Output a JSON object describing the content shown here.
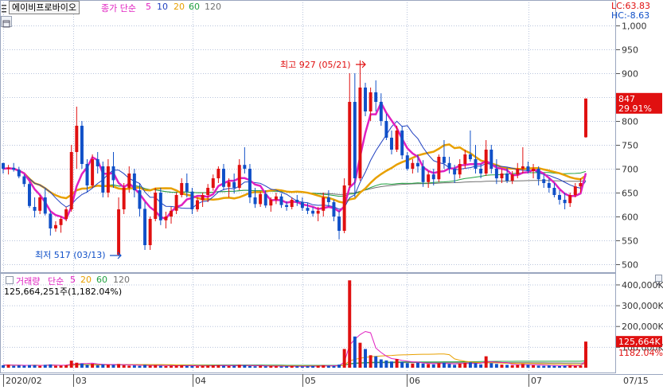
{
  "header": {
    "stock_name": "에이비프로바이오",
    "price_ma_label": "종가 단순",
    "ma_periods": [
      "5",
      "10",
      "20",
      "60",
      "120"
    ],
    "ma_colors": [
      "#e020c0",
      "#2040c0",
      "#e8a000",
      "#20a040",
      "#707070"
    ],
    "lc_text": "LC:63.83",
    "hc_text": "HC:-8.63"
  },
  "volume_header": {
    "label": "거래량",
    "ma_label": "단순",
    "ma_periods": [
      "5",
      "20",
      "60",
      "120"
    ],
    "ma_colors": [
      "#e020c0",
      "#e8a000",
      "#20a040",
      "#707070"
    ],
    "value_text": "125,664,251주(1,182.04%)"
  },
  "price_axis": {
    "ticks": [
      "1,000",
      "950",
      "900",
      "850",
      "800",
      "750",
      "700",
      "650",
      "600",
      "550",
      "500"
    ],
    "current_price": "847",
    "current_change": "29.91%"
  },
  "volume_axis": {
    "ticks": [
      "400,000K",
      "300,000K",
      "200,000K",
      "100,000K"
    ],
    "current_volume": "125,664K",
    "current_ratio": "1182.04%"
  },
  "date_axis": {
    "labels": [
      "2020/02",
      "03",
      "04",
      "05",
      "06",
      "07"
    ],
    "last_date": "07/15"
  },
  "annotations": {
    "high": "최고 927 (05/21)",
    "low": "최저 517 (03/13)"
  },
  "colors": {
    "up": "#e01010",
    "down": "#1050c8",
    "grid": "#b8c4dc",
    "axis_bg": "#ffffff"
  },
  "chart_data": [
    {
      "type": "candlestick",
      "title": "",
      "ylim": [
        490,
        1020
      ],
      "series_note": "daily OHLC",
      "ohlc": [
        [
          712,
          712,
          690,
          700
        ],
        [
          700,
          708,
          688,
          702
        ],
        [
          702,
          712,
          694,
          698
        ],
        [
          698,
          704,
          680,
          684
        ],
        [
          684,
          688,
          662,
          668
        ],
        [
          668,
          672,
          618,
          622
        ],
        [
          620,
          640,
          598,
          612
        ],
        [
          612,
          645,
          605,
          640
        ],
        [
          640,
          660,
          602,
          606
        ],
        [
          606,
          612,
          560,
          575
        ],
        [
          575,
          590,
          568,
          582
        ],
        [
          582,
          600,
          566,
          595
        ],
        [
          595,
          620,
          590,
          615
        ],
        [
          615,
          750,
          610,
          735
        ],
        [
          735,
          830,
          700,
          790
        ],
        [
          790,
          800,
          700,
          710
        ],
        [
          710,
          720,
          650,
          665
        ],
        [
          665,
          730,
          660,
          720
        ],
        [
          720,
          735,
          690,
          705
        ],
        [
          705,
          715,
          640,
          650
        ],
        [
          650,
          720,
          640,
          705
        ],
        [
          705,
          735,
          660,
          676
        ],
        [
          520,
          640,
          517,
          615
        ],
        [
          615,
          670,
          605,
          660
        ],
        [
          660,
          705,
          650,
          690
        ],
        [
          690,
          700,
          640,
          655
        ],
        [
          655,
          670,
          600,
          616
        ],
        [
          616,
          630,
          530,
          540
        ],
        [
          540,
          600,
          530,
          595
        ],
        [
          595,
          660,
          590,
          650
        ],
        [
          650,
          660,
          582,
          592
        ],
        [
          592,
          610,
          575,
          600
        ],
        [
          600,
          620,
          585,
          612
        ],
        [
          612,
          650,
          605,
          645
        ],
        [
          645,
          680,
          640,
          670
        ],
        [
          670,
          690,
          640,
          652
        ],
        [
          652,
          660,
          605,
          615
        ],
        [
          615,
          640,
          610,
          634
        ],
        [
          634,
          650,
          620,
          645
        ],
        [
          645,
          668,
          630,
          660
        ],
        [
          660,
          688,
          654,
          680
        ],
        [
          680,
          705,
          670,
          700
        ],
        [
          700,
          710,
          655,
          662
        ],
        [
          662,
          680,
          640,
          672
        ],
        [
          672,
          690,
          648,
          660
        ],
        [
          660,
          720,
          655,
          708
        ],
        [
          708,
          745,
          690,
          700
        ],
        [
          700,
          710,
          628,
          640
        ],
        [
          640,
          660,
          618,
          626
        ],
        [
          626,
          652,
          620,
          647
        ],
        [
          647,
          655,
          618,
          623
        ],
        [
          623,
          640,
          610,
          635
        ],
        [
          635,
          650,
          626,
          642
        ],
        [
          642,
          648,
          618,
          624
        ],
        [
          624,
          632,
          612,
          620
        ],
        [
          620,
          640,
          615,
          635
        ],
        [
          635,
          645,
          622,
          630
        ],
        [
          630,
          640,
          612,
          618
        ],
        [
          618,
          628,
          605,
          612
        ],
        [
          612,
          620,
          600,
          606
        ],
        [
          606,
          620,
          590,
          612
        ],
        [
          612,
          650,
          600,
          640
        ],
        [
          640,
          655,
          620,
          630
        ],
        [
          630,
          635,
          590,
          600
        ],
        [
          600,
          612,
          552,
          570
        ],
        [
          570,
          680,
          565,
          665
        ],
        [
          665,
          900,
          660,
          840
        ],
        [
          840,
          900,
          640,
          680
        ],
        [
          680,
          927,
          675,
          870
        ],
        [
          870,
          880,
          810,
          820
        ],
        [
          820,
          870,
          800,
          860
        ],
        [
          860,
          885,
          820,
          840
        ],
        [
          840,
          858,
          790,
          800
        ],
        [
          800,
          815,
          760,
          765
        ],
        [
          765,
          780,
          730,
          740
        ],
        [
          740,
          790,
          735,
          780
        ],
        [
          780,
          790,
          720,
          728
        ],
        [
          728,
          735,
          696,
          700
        ],
        [
          700,
          720,
          690,
          712
        ],
        [
          712,
          730,
          692,
          705
        ],
        [
          705,
          718,
          662,
          672
        ],
        [
          672,
          695,
          660,
          688
        ],
        [
          688,
          700,
          665,
          678
        ],
        [
          678,
          730,
          672,
          725
        ],
        [
          725,
          760,
          700,
          712
        ],
        [
          712,
          725,
          690,
          700
        ],
        [
          700,
          708,
          670,
          688
        ],
        [
          688,
          720,
          680,
          710
        ],
        [
          710,
          740,
          700,
          730
        ],
        [
          730,
          780,
          715,
          720
        ],
        [
          720,
          750,
          690,
          700
        ],
        [
          700,
          710,
          680,
          690
        ],
        [
          690,
          760,
          685,
          740
        ],
        [
          740,
          750,
          690,
          700
        ],
        [
          700,
          720,
          668,
          680
        ],
        [
          680,
          700,
          670,
          690
        ],
        [
          690,
          702,
          670,
          675
        ],
        [
          675,
          695,
          668,
          688
        ],
        [
          688,
          712,
          680,
          700
        ],
        [
          700,
          745,
          690,
          705
        ],
        [
          705,
          715,
          690,
          695
        ],
        [
          695,
          710,
          680,
          700
        ],
        [
          700,
          705,
          665,
          678
        ],
        [
          678,
          690,
          660,
          670
        ],
        [
          670,
          680,
          650,
          660
        ],
        [
          660,
          670,
          640,
          645
        ],
        [
          645,
          655,
          625,
          635
        ],
        [
          635,
          650,
          615,
          628
        ],
        [
          628,
          650,
          620,
          645
        ],
        [
          645,
          670,
          640,
          663
        ],
        [
          663,
          680,
          650,
          670
        ],
        [
          766,
          847,
          765,
          847
        ]
      ],
      "volume_k": [
        12000,
        15000,
        9000,
        11000,
        10000,
        13000,
        12000,
        9000,
        14000,
        16000,
        9000,
        10000,
        12000,
        34000,
        24000,
        20000,
        14000,
        19000,
        12000,
        16000,
        15000,
        14000,
        18000,
        12000,
        10000,
        11000,
        9000,
        14000,
        10000,
        12000,
        9000,
        8000,
        9000,
        10000,
        11000,
        9000,
        8000,
        7000,
        9000,
        10000,
        11000,
        12000,
        9000,
        8000,
        9000,
        14000,
        12000,
        8000,
        7000,
        9000,
        7000,
        8000,
        7000,
        6000,
        7000,
        8000,
        7000,
        6000,
        7000,
        8000,
        9000,
        12000,
        9000,
        8000,
        15000,
        90000,
        420000,
        150000,
        120000,
        90000,
        60000,
        55000,
        40000,
        35000,
        30000,
        42000,
        28000,
        22000,
        20000,
        24000,
        20000,
        18000,
        16000,
        22000,
        24000,
        18000,
        14000,
        20000,
        24000,
        26000,
        22000,
        16000,
        55000,
        22000,
        18000,
        15000,
        14000,
        12000,
        14000,
        18000,
        14000,
        12000,
        10000,
        9000,
        11000,
        9000,
        8000,
        10000,
        12000,
        9000,
        10000,
        125664
      ]
    }
  ]
}
